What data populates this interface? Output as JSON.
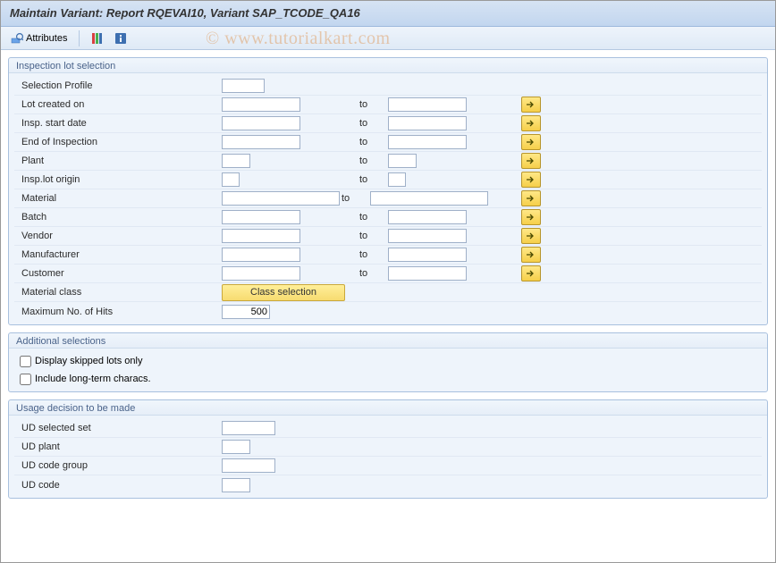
{
  "header": {
    "title": "Maintain Variant: Report RQEVAI10, Variant SAP_TCODE_QA16"
  },
  "toolbar": {
    "attributes": "Attributes"
  },
  "watermark": "© www.tutorialkart.com",
  "groups": {
    "inspection": {
      "title": "Inspection lot selection",
      "rows": {
        "selection_profile": "Selection Profile",
        "lot_created_on": "Lot created on",
        "insp_start_date": "Insp. start date",
        "end_of_inspection": "End of Inspection",
        "plant": "Plant",
        "insp_lot_origin": "Insp.lot origin",
        "material": "Material",
        "batch": "Batch",
        "vendor": "Vendor",
        "manufacturer": "Manufacturer",
        "customer": "Customer",
        "material_class": "Material class",
        "max_hits": "Maximum No. of Hits"
      },
      "to": "to",
      "class_button": "Class selection",
      "max_hits_value": "500"
    },
    "additional": {
      "title": "Additional selections",
      "display_skipped": "Display skipped lots only",
      "include_longterm": "Include long-term characs."
    },
    "usage": {
      "title": "Usage decision to be made",
      "ud_selected_set": "UD selected set",
      "ud_plant": "UD plant",
      "ud_code_group": "UD code group",
      "ud_code": "UD code"
    }
  }
}
